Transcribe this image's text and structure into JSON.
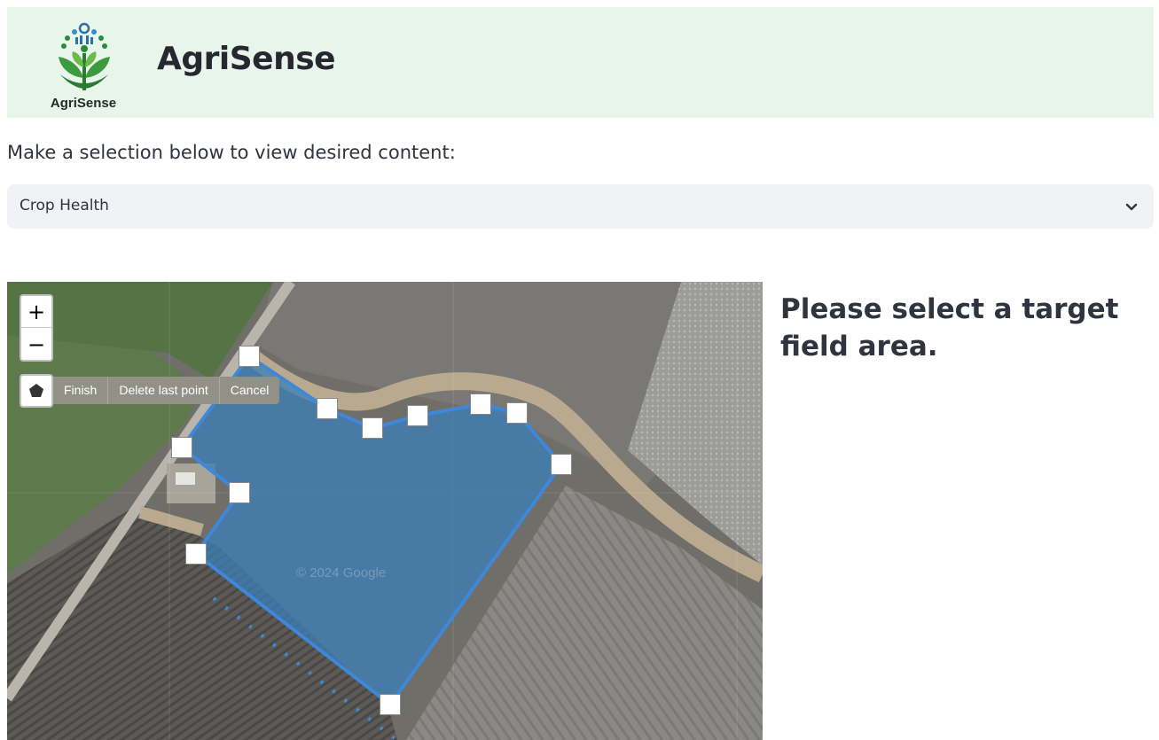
{
  "header": {
    "logo_text": "AgriSense",
    "app_title": "AgriSense"
  },
  "content_select": {
    "prompt": "Make a selection below to view desired content:",
    "selected": "Crop Health"
  },
  "map": {
    "zoom_in_label": "+",
    "zoom_out_label": "−",
    "draw_actions": [
      "Finish",
      "Delete last point",
      "Cancel"
    ],
    "watermark": "© 2024 Google",
    "polygon_color": "#3f87d8"
  },
  "message": "Please select a target field area.",
  "colors": {
    "header_bg": "#e8f5ea",
    "select_bg": "#f0f2f6",
    "text": "#31333f"
  }
}
